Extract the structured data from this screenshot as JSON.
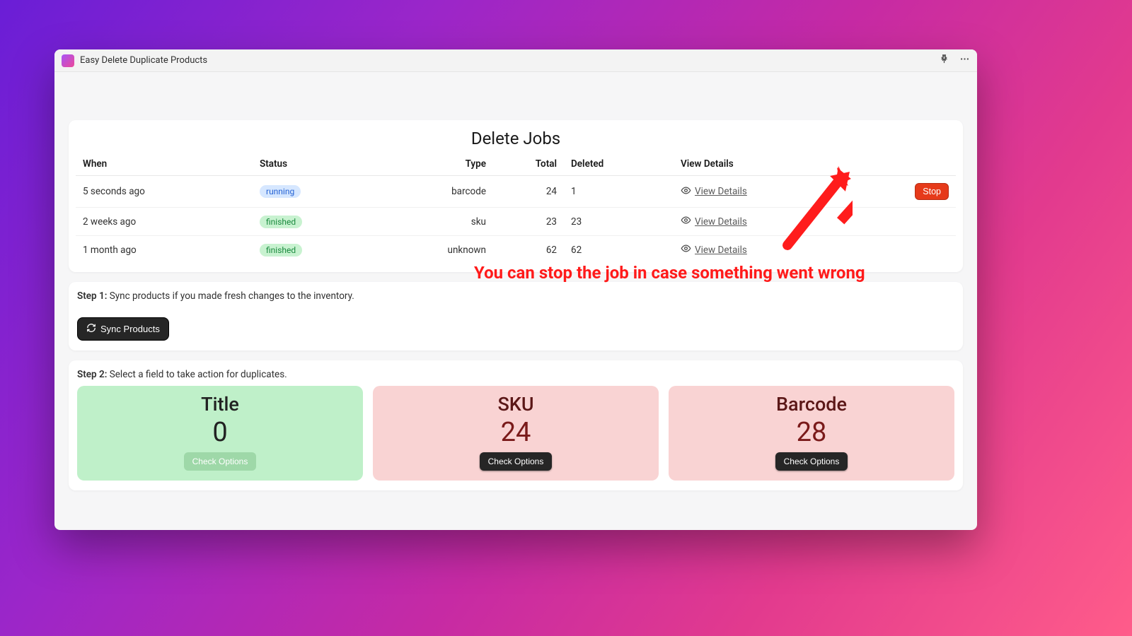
{
  "titlebar": {
    "app_name": "Easy Delete Duplicate Products"
  },
  "jobs_card": {
    "title": "Delete Jobs",
    "headers": {
      "when": "When",
      "status": "Status",
      "type": "Type",
      "total": "Total",
      "deleted": "Deleted",
      "view": "View Details"
    },
    "view_details_label": "View Details",
    "stop_label": "Stop",
    "rows": [
      {
        "when": "5 seconds ago",
        "status_label": "running",
        "status_kind": "running",
        "type": "barcode",
        "total": "24",
        "deleted": "1",
        "stoppable": true
      },
      {
        "when": "2 weeks ago",
        "status_label": "finished",
        "status_kind": "finished",
        "type": "sku",
        "total": "23",
        "deleted": "23",
        "stoppable": false
      },
      {
        "when": "1 month ago",
        "status_label": "finished",
        "status_kind": "finished",
        "type": "unknown",
        "total": "62",
        "deleted": "62",
        "stoppable": false
      }
    ]
  },
  "step1": {
    "label": "Step 1:",
    "text": "Sync products if you made fresh changes to the inventory.",
    "button": "Sync Products"
  },
  "step2": {
    "label": "Step 2:",
    "text": "Select a field to take action for duplicates.",
    "check_label": "Check Options",
    "tiles": [
      {
        "title": "Title",
        "count": "0",
        "ok": true
      },
      {
        "title": "SKU",
        "count": "24",
        "ok": false
      },
      {
        "title": "Barcode",
        "count": "28",
        "ok": false
      }
    ]
  },
  "annotation": {
    "text": "You can stop the job in case something went wrong"
  }
}
